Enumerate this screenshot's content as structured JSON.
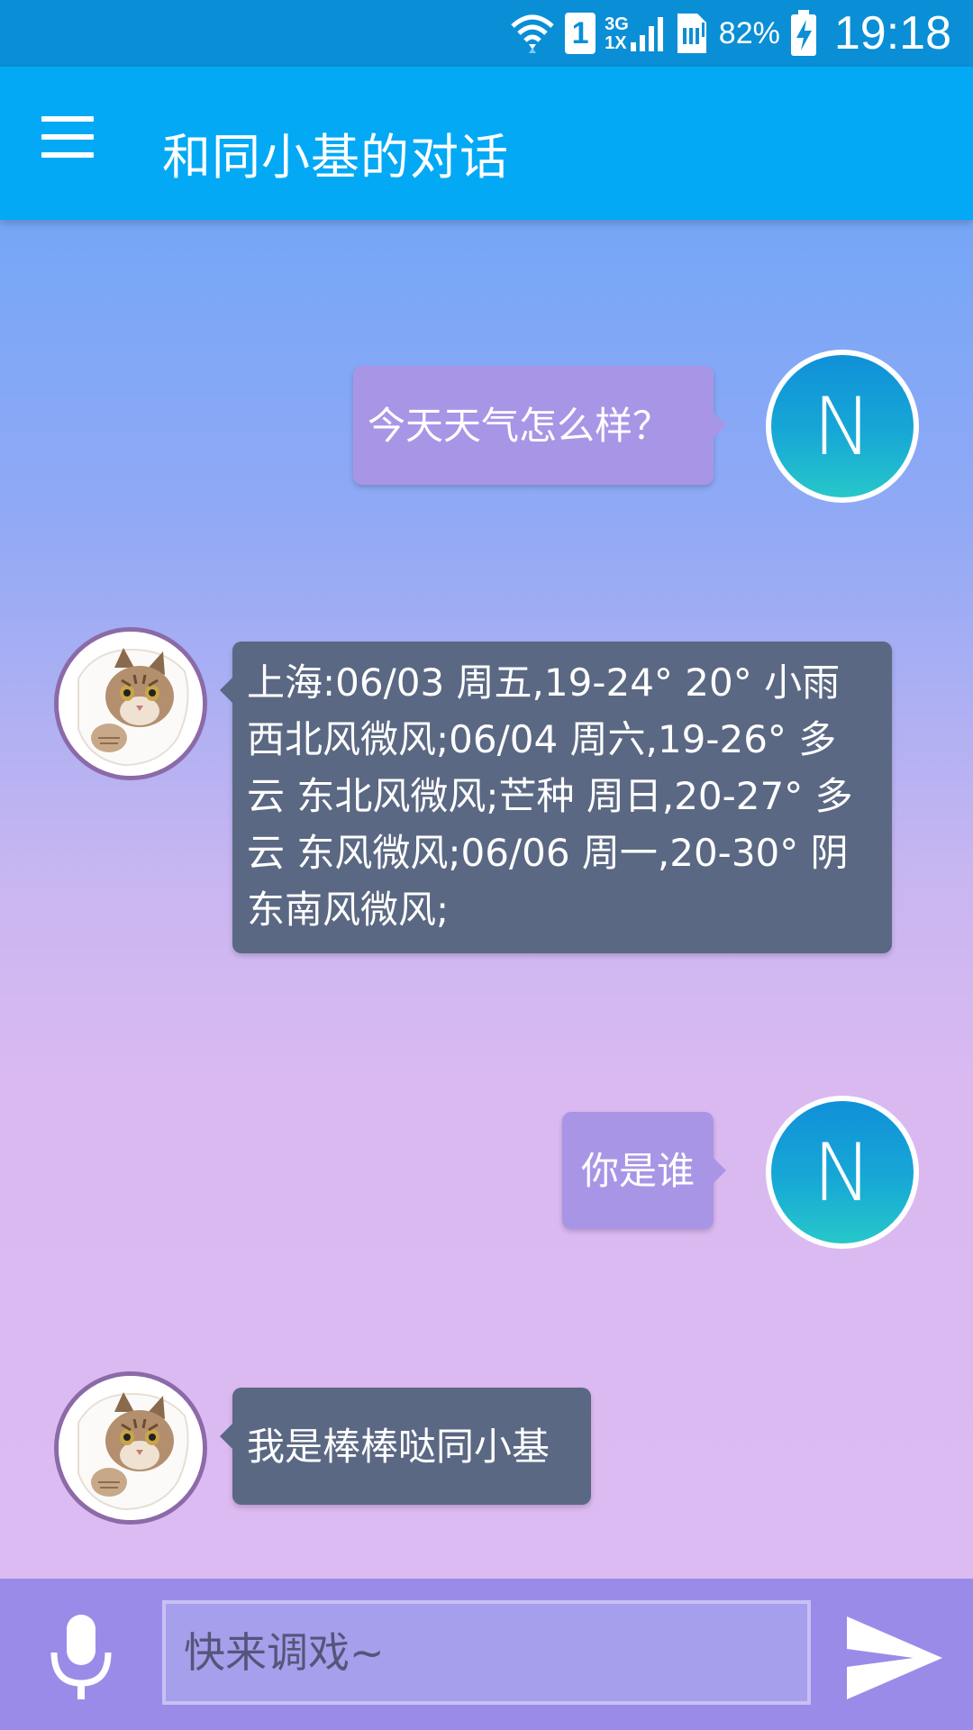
{
  "status_bar": {
    "sim_label": "1",
    "network_top": "3G",
    "network_bottom": "1X",
    "battery_percent": "82%",
    "time": "19:18"
  },
  "app_bar": {
    "title": "和同小基的对话",
    "menu_icon": "hamburger-menu-icon"
  },
  "messages": [
    {
      "sender": "user",
      "avatar_letter": "N",
      "text": "今天天气怎么样？"
    },
    {
      "sender": "bot",
      "avatar": "cat-avatar",
      "lines": [
        "上海:06/03 周五,19-24° 20° 小雨",
        "西北风微风;06/04 周六,19-26° 多",
        "云 东北风微风;芒种 周日,20-27° 多",
        "云 东风微风;06/06 周一,20-30° 阴",
        "东南风微风;"
      ]
    },
    {
      "sender": "user",
      "avatar_letter": "N",
      "text": "你是谁"
    },
    {
      "sender": "bot",
      "avatar": "cat-avatar",
      "text": "我是棒棒哒同小基"
    }
  ],
  "input_bar": {
    "placeholder": "快来调戏~",
    "mic_icon": "microphone-icon",
    "send_icon": "send-icon"
  },
  "colors": {
    "status_bar": "#0a8fd6",
    "app_bar": "#03a9f4",
    "user_bubble": "#a995e6",
    "bot_bubble": "#5b6883",
    "input_bar": "#9b8be8"
  }
}
